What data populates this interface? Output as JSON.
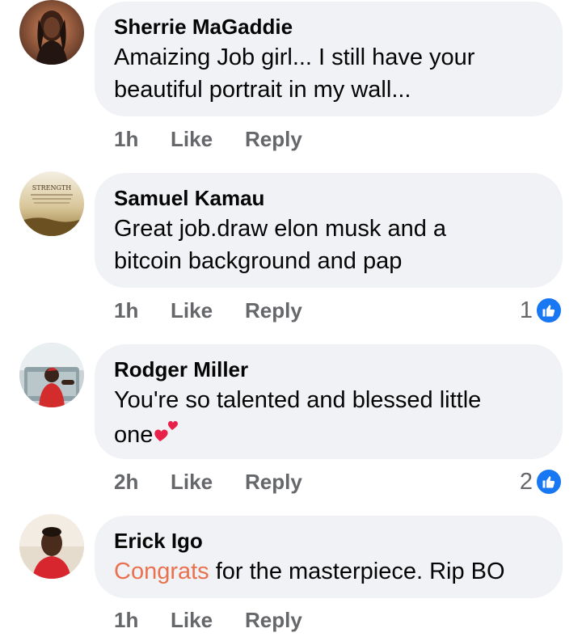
{
  "comments": [
    {
      "author": "Sherrie MaGaddie",
      "lines": [
        "Amaizing Job girl... I still have your",
        "beautiful portrait in my wall..."
      ],
      "time": "1h",
      "like": "Like",
      "reply": "Reply"
    },
    {
      "author": "Samuel Kamau",
      "avatar_text": "STRENGTH",
      "lines": [
        "Great job.draw elon musk and a",
        "bitcoin background and pap"
      ],
      "time": "1h",
      "like": "Like",
      "reply": "Reply",
      "reactions": "1"
    },
    {
      "author": "Rodger Miller",
      "lines": [
        "You're so talented and blessed little",
        "one"
      ],
      "emoji": "two-hearts-icon",
      "time": "2h",
      "like": "Like",
      "reply": "Reply",
      "reactions": "2"
    },
    {
      "author": "Erick Igo",
      "highlight": "Congrats",
      "text_rest": " for the masterpiece. Rip BO",
      "time": "1h",
      "like": "Like",
      "reply": "Reply"
    }
  ],
  "colors": {
    "bubble_bg": "#f0f2f5",
    "meta_text": "#65676b",
    "like_blue": "#1877f2",
    "highlight": "#e9714f"
  }
}
